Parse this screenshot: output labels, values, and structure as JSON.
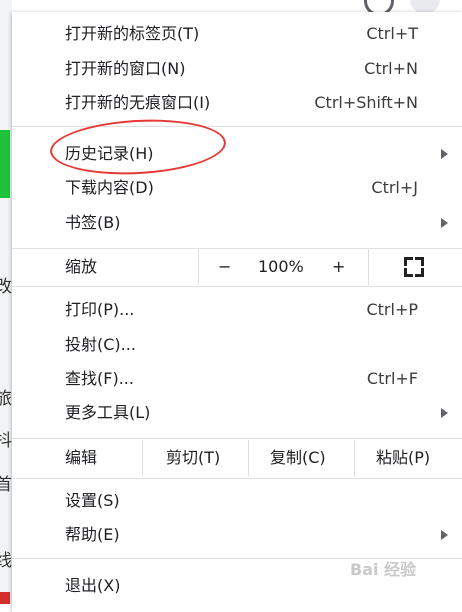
{
  "menu": {
    "items": [
      {
        "label": "打开新的标签页(T)",
        "shortcut": "Ctrl+T"
      },
      {
        "label": "打开新的窗口(N)",
        "shortcut": "Ctrl+N"
      },
      {
        "label": "打开新的无痕窗口(I)",
        "shortcut": "Ctrl+Shift+N"
      },
      {
        "label": "历史记录(H)",
        "submenu": true
      },
      {
        "label": "下载内容(D)",
        "shortcut": "Ctrl+J"
      },
      {
        "label": "书签(B)",
        "submenu": true
      },
      {
        "label": "打印(P)...",
        "shortcut": "Ctrl+P"
      },
      {
        "label": "投射(C)..."
      },
      {
        "label": "查找(F)...",
        "shortcut": "Ctrl+F"
      },
      {
        "label": "更多工具(L)",
        "submenu": true
      },
      {
        "label": "设置(S)"
      },
      {
        "label": "帮助(E)",
        "submenu": true
      },
      {
        "label": "退出(X)"
      }
    ],
    "zoom": {
      "label": "缩放",
      "minus": "−",
      "value": "100%",
      "plus": "+"
    },
    "edit": {
      "label": "编辑",
      "cut": "剪切(T)",
      "copy": "复制(C)",
      "paste": "粘贴(P)"
    }
  },
  "background": {
    "side_chars": [
      "改",
      "旅",
      "抖",
      "首",
      "线"
    ]
  },
  "watermark": "Bai 经验",
  "colors": {
    "annotation": "#e53935",
    "green_strip": "#1ec33a"
  }
}
